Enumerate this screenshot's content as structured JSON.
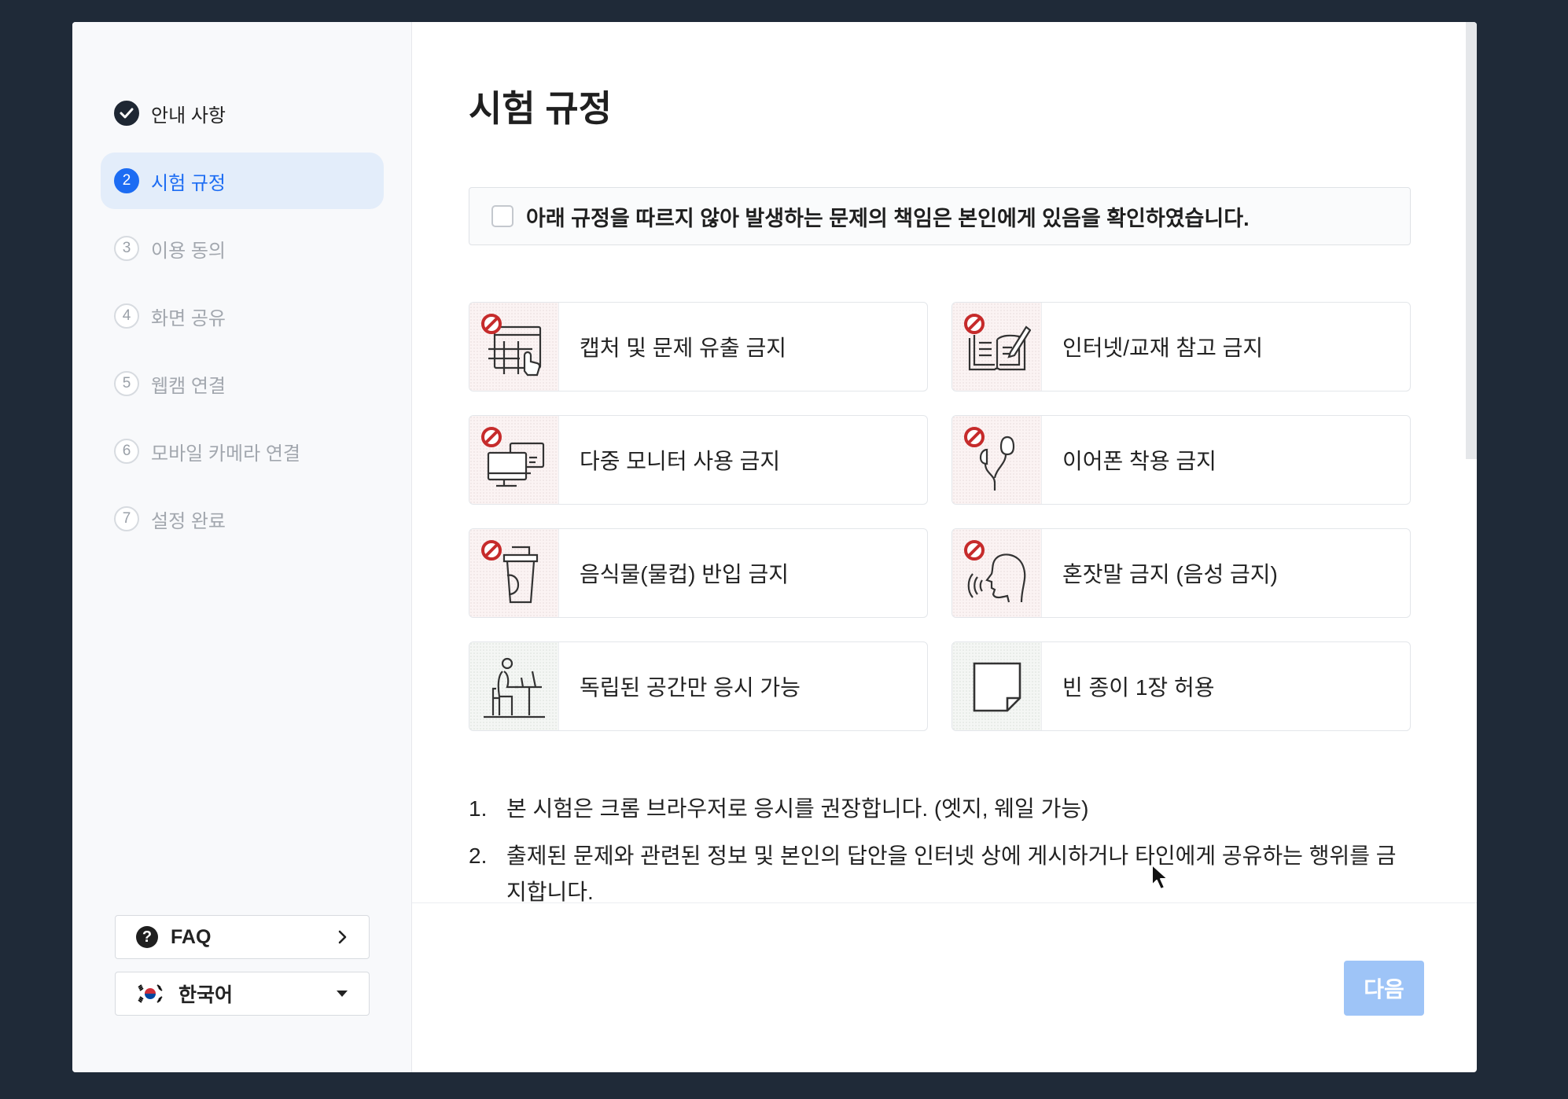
{
  "sidebar": {
    "steps": [
      {
        "num": "",
        "label": "안내 사항",
        "state": "done"
      },
      {
        "num": "2",
        "label": "시험 규정",
        "state": "active"
      },
      {
        "num": "3",
        "label": "이용 동의",
        "state": "pending"
      },
      {
        "num": "4",
        "label": "화면 공유",
        "state": "pending"
      },
      {
        "num": "5",
        "label": "웹캠 연결",
        "state": "pending"
      },
      {
        "num": "6",
        "label": "모바일 카메라 연결",
        "state": "pending"
      },
      {
        "num": "7",
        "label": "설정 완료",
        "state": "pending"
      }
    ],
    "faq_label": "FAQ",
    "language_label": "한국어"
  },
  "main": {
    "title": "시험 규정",
    "agree_text": "아래 규정을 따르지 않아 발생하는 문제의 책임은 본인에게 있음을 확인하였습니다.",
    "agree_checked": false,
    "rules": [
      {
        "label": "캡처 및 문제 유출 금지",
        "icon": "screen-capture-icon",
        "prohibited": true
      },
      {
        "label": "인터넷/교재 참고 금지",
        "icon": "book-reference-icon",
        "prohibited": true
      },
      {
        "label": "다중 모니터 사용 금지",
        "icon": "multi-monitor-icon",
        "prohibited": true
      },
      {
        "label": "이어폰 착용 금지",
        "icon": "earphone-icon",
        "prohibited": true
      },
      {
        "label": "음식물(물컵) 반입 금지",
        "icon": "drink-cup-icon",
        "prohibited": true
      },
      {
        "label": "혼잣말 금지 (음성 금지)",
        "icon": "speaking-icon",
        "prohibited": true
      },
      {
        "label": "독립된 공간만 응시 가능",
        "icon": "person-at-desk-icon",
        "prohibited": false
      },
      {
        "label": "빈 종이 1장 허용",
        "icon": "blank-paper-icon",
        "prohibited": false
      }
    ],
    "notes": [
      {
        "num": "1.",
        "text": "본 시험은 크롬 브라우저로 응시를 권장합니다. (엣지, 웨일 가능)"
      },
      {
        "num": "2.",
        "text": "출제된 문제와 관련된 정보 및 본인의 답안을 인터넷 상에 게시하거나 타인에게 공유하는 행위를 금지합니다."
      }
    ],
    "next_label": "다음"
  },
  "colors": {
    "accent": "#1c6cf3",
    "active_step_bg": "#e3edfa",
    "next_disabled": "#9ec4f7",
    "prohibit_red": "#c62b2b",
    "backdrop": "#1f2a38"
  }
}
